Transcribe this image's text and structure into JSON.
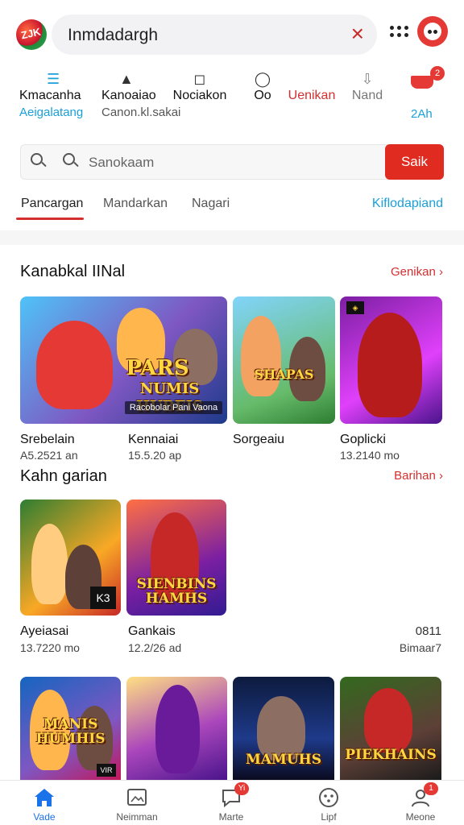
{
  "header": {
    "logo_text": "ZJK",
    "search_query": "Inmdadargh",
    "clear_icon": "close-icon"
  },
  "categories": [
    {
      "label": "Kmacanha",
      "sub": "Aeigalatang",
      "icon": "menu-icon"
    },
    {
      "label": "Kanoaiao",
      "sub": "Canon.kl.sakai",
      "icon": "triangle-icon"
    },
    {
      "label": "Nociakon",
      "sub": "",
      "icon": "square-icon"
    },
    {
      "label": "Oo",
      "sub": "",
      "icon": "circle-icon"
    },
    {
      "label": "Uenikan",
      "sub": "",
      "icon": "text-icon"
    },
    {
      "label": "Nand",
      "sub": "",
      "icon": "download-icon"
    },
    {
      "label": "",
      "sub": "2Ah",
      "icon": "cart-icon",
      "badge": "2"
    }
  ],
  "search": {
    "placeholder": "Sanokaam",
    "button_label": "Saik"
  },
  "tabs": [
    {
      "label": "Pancargan",
      "active": true
    },
    {
      "label": "Mandarkan",
      "active": false
    },
    {
      "label": "Nagari",
      "active": false
    }
  ],
  "tab_link": "Kiflodapiand",
  "section1": {
    "title": "Kanabkal IINal",
    "more": "Genikan",
    "games": [
      {
        "art_title": "PARS",
        "art_title2": "NUMIS HUBEIS",
        "art_sub": "Racobolar Pani Vaona",
        "name": "Srebelain",
        "meta": "A5.2521 an"
      },
      {
        "art_title": "",
        "art_title2": "",
        "art_sub": "",
        "name": "Kennaiai",
        "meta": "15.5.20 ap"
      },
      {
        "art_title": "SHAPAS",
        "art_title2": "",
        "art_sub": "",
        "name": "Sorgeaiu",
        "meta": ""
      },
      {
        "art_title": "",
        "art_title2": "",
        "art_sub": "",
        "name": "Goplicki",
        "meta": "13.2140 mo"
      }
    ]
  },
  "section2": {
    "title": "Kahn garian",
    "more": "Barihan",
    "games": [
      {
        "art_title": "",
        "corner": "K3",
        "name": "Ayeiasai",
        "meta": "13.7220 mo"
      },
      {
        "art_title": "SIENBINS HAMHS",
        "name": "Gankais",
        "meta": "12.2/26 ad"
      }
    ],
    "side_value": "0811",
    "side_meta": "Bimaar7"
  },
  "section3": {
    "games": [
      {
        "art_title": "MANIS HUMHIS",
        "corner": "VIR"
      },
      {
        "art_title": ""
      },
      {
        "art_title": "MAMUHS"
      },
      {
        "art_title": "PIEKHAINS"
      }
    ]
  },
  "bottom_nav": [
    {
      "label": "Vade",
      "icon": "home-icon",
      "active": true
    },
    {
      "label": "Neimman",
      "icon": "image-icon",
      "active": false
    },
    {
      "label": "Marte",
      "icon": "chat-icon",
      "active": false,
      "badge": "Yi"
    },
    {
      "label": "Lipf",
      "icon": "compass-icon",
      "active": false
    },
    {
      "label": "Meone",
      "icon": "user-icon",
      "active": false,
      "badge": "1"
    }
  ],
  "colors": {
    "accent_red": "#e02b20",
    "link_blue": "#1aa0d8",
    "nav_active": "#1a73e8"
  }
}
